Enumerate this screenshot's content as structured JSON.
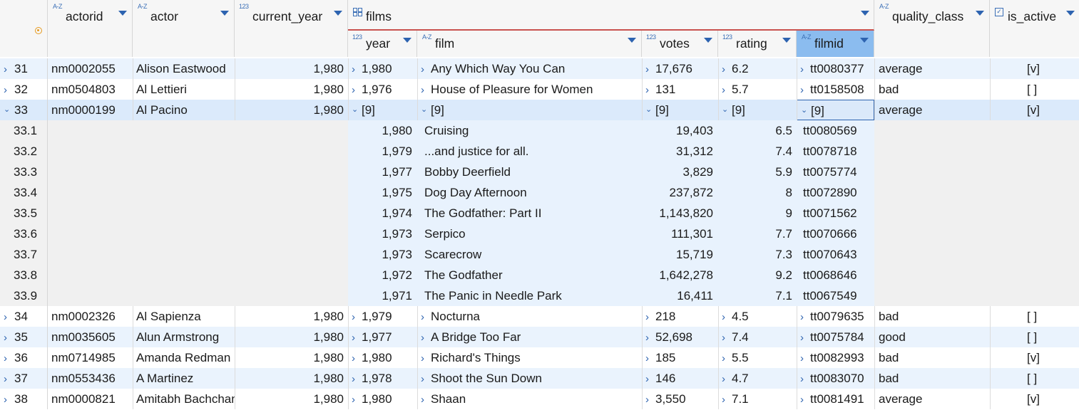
{
  "columns": {
    "actorid": {
      "type": "A-Z",
      "label": "actorid"
    },
    "actor": {
      "type": "A-Z",
      "label": "actor"
    },
    "current_year": {
      "type": "123",
      "label": "current_year"
    },
    "films": {
      "type": "group",
      "label": "films"
    },
    "year": {
      "type": "123",
      "label": "year"
    },
    "film": {
      "type": "A-Z",
      "label": "film"
    },
    "votes": {
      "type": "123",
      "label": "votes"
    },
    "rating": {
      "type": "123",
      "label": "rating"
    },
    "filmid": {
      "type": "A-Z",
      "label": "filmid"
    },
    "quality_class": {
      "type": "A-Z",
      "label": "quality_class"
    },
    "is_active": {
      "type": "checkbox",
      "label": "is_active"
    }
  },
  "rows": [
    {
      "num": "31",
      "actorid": "nm0002055",
      "actor": "Alison Eastwood",
      "current_year": "1,980",
      "year": "1,980",
      "film": "Any Which Way You Can",
      "votes": "17,676",
      "rating": "6.2",
      "filmid": "tt0080377",
      "quality_class": "average",
      "is_active": "[v]"
    },
    {
      "num": "32",
      "actorid": "nm0504803",
      "actor": "Al Lettieri",
      "current_year": "1,980",
      "year": "1,976",
      "film": "House of Pleasure for Women",
      "votes": "131",
      "rating": "5.7",
      "filmid": "tt0158508",
      "quality_class": "bad",
      "is_active": "[ ]"
    },
    {
      "num": "33",
      "actorid": "nm0000199",
      "actor": "Al Pacino",
      "current_year": "1,980",
      "year": "[9]",
      "film": "[9]",
      "votes": "[9]",
      "rating": "[9]",
      "filmid": "[9]",
      "quality_class": "average",
      "is_active": "[v]"
    }
  ],
  "subrows": [
    {
      "num": "33.1",
      "year": "1,980",
      "film": "Cruising",
      "votes": "19,403",
      "rating": "6.5",
      "filmid": "tt0080569"
    },
    {
      "num": "33.2",
      "year": "1,979",
      "film": "...and justice for all.",
      "votes": "31,312",
      "rating": "7.4",
      "filmid": "tt0078718"
    },
    {
      "num": "33.3",
      "year": "1,977",
      "film": "Bobby Deerfield",
      "votes": "3,829",
      "rating": "5.9",
      "filmid": "tt0075774"
    },
    {
      "num": "33.4",
      "year": "1,975",
      "film": "Dog Day Afternoon",
      "votes": "237,872",
      "rating": "8",
      "filmid": "tt0072890"
    },
    {
      "num": "33.5",
      "year": "1,974",
      "film": "The Godfather: Part II",
      "votes": "1,143,820",
      "rating": "9",
      "filmid": "tt0071562"
    },
    {
      "num": "33.6",
      "year": "1,973",
      "film": "Serpico",
      "votes": "111,301",
      "rating": "7.7",
      "filmid": "tt0070666"
    },
    {
      "num": "33.7",
      "year": "1,973",
      "film": "Scarecrow",
      "votes": "15,719",
      "rating": "7.3",
      "filmid": "tt0070643"
    },
    {
      "num": "33.8",
      "year": "1,972",
      "film": "The Godfather",
      "votes": "1,642,278",
      "rating": "9.2",
      "filmid": "tt0068646"
    },
    {
      "num": "33.9",
      "year": "1,971",
      "film": "The Panic in Needle Park",
      "votes": "16,411",
      "rating": "7.1",
      "filmid": "tt0067549"
    }
  ],
  "rows_after": [
    {
      "num": "34",
      "actorid": "nm0002326",
      "actor": "Al Sapienza",
      "current_year": "1,980",
      "year": "1,979",
      "film": "Nocturna",
      "votes": "218",
      "rating": "4.5",
      "filmid": "tt0079635",
      "quality_class": "bad",
      "is_active": "[ ]"
    },
    {
      "num": "35",
      "actorid": "nm0035605",
      "actor": "Alun Armstrong",
      "current_year": "1,980",
      "year": "1,977",
      "film": "A Bridge Too Far",
      "votes": "52,698",
      "rating": "7.4",
      "filmid": "tt0075784",
      "quality_class": "good",
      "is_active": "[ ]"
    },
    {
      "num": "36",
      "actorid": "nm0714985",
      "actor": "Amanda Redman",
      "current_year": "1,980",
      "year": "1,980",
      "film": "Richard's Things",
      "votes": "185",
      "rating": "5.5",
      "filmid": "tt0082993",
      "quality_class": "bad",
      "is_active": "[v]"
    },
    {
      "num": "37",
      "actorid": "nm0553436",
      "actor": "A Martinez",
      "current_year": "1,980",
      "year": "1,978",
      "film": "Shoot the Sun Down",
      "votes": "146",
      "rating": "4.7",
      "filmid": "tt0083070",
      "quality_class": "bad",
      "is_active": "[ ]"
    },
    {
      "num": "38",
      "actorid": "nm0000821",
      "actor": "Amitabh Bachchan",
      "current_year": "1,980",
      "year": "1,980",
      "film": "Shaan",
      "votes": "3,550",
      "rating": "7.1",
      "filmid": "tt0081491",
      "quality_class": "average",
      "is_active": "[v]"
    }
  ],
  "colors": {
    "header_bg": "#f6f6f6",
    "row_alt": "#eaf3fd",
    "selected_row": "#dbeafb",
    "sub_bg": "#e8f2fd",
    "selected_header": "#8bbcef",
    "focus_border": "#2d63b0",
    "accent": "#2d63b0",
    "film_group_border": "#c9524f"
  },
  "icons": {
    "row_expand": "chevron-right-icon",
    "row_collapse": "chevron-down-icon",
    "corner": "target-icon",
    "sort": "sort-arrow-icon",
    "active": "checkbox-icon",
    "group": "grid-icon"
  }
}
